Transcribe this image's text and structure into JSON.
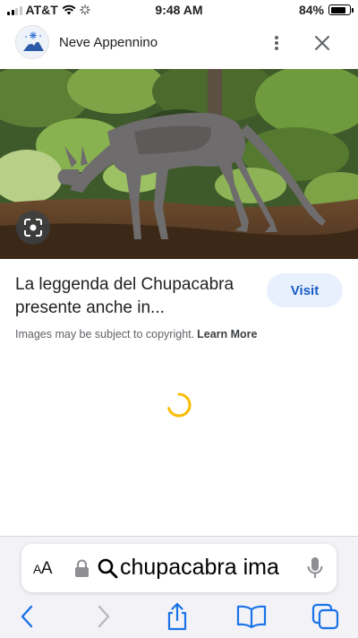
{
  "status_bar": {
    "carrier": "AT&T",
    "time": "9:48 AM",
    "battery_percent": "84%",
    "battery_level": 0.84,
    "signal_bars": 2
  },
  "header": {
    "site_name": "Neve Appennino",
    "logo_icon": "snowflake-mountain-logo",
    "more_icon": "more-vertical-icon",
    "close_icon": "close-icon"
  },
  "result": {
    "title": "La leggenda del Chupacabra presente anche in...",
    "visit_label": "Visit",
    "copyright_text": "Images may be subject to copyright.",
    "learn_more": "Learn More"
  },
  "browser": {
    "text_size_label": "AA",
    "search_text": "chupacabra ima",
    "lock_icon": "lock-icon",
    "search_icon": "search-icon",
    "mic_icon": "microphone-icon"
  },
  "toolbar": {
    "back_icon": "back-chevron-icon",
    "forward_icon": "forward-chevron-icon",
    "share_icon": "share-icon",
    "bookmarks_icon": "book-icon",
    "tabs_icon": "tabs-icon"
  },
  "colors": {
    "accent_blue": "#1a73e8",
    "visit_bg": "#e8f0fe",
    "spinner_yellow": "#fbbc04",
    "toolbar_bg": "#f2f2f7"
  }
}
